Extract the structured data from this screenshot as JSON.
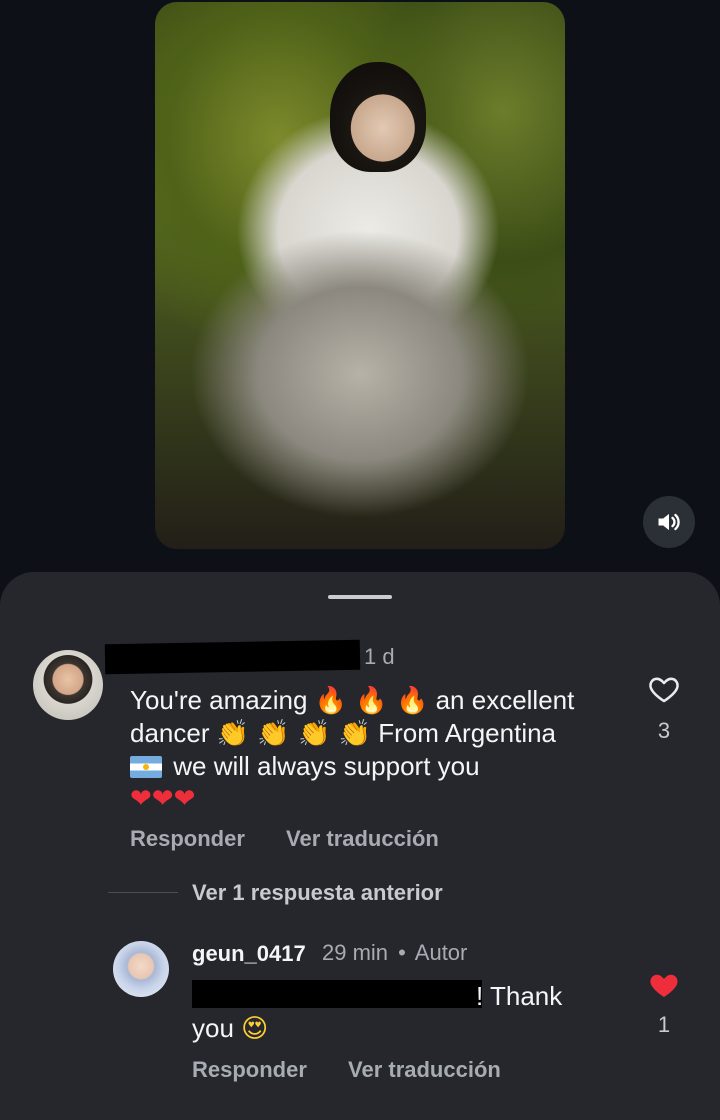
{
  "video": {
    "sound_icon": "volume-icon"
  },
  "comments": [
    {
      "timestamp": "1 d",
      "text_part1": "You're amazing",
      "fire_emojis": "🔥 🔥 🔥",
      "text_part2": "an excellent",
      "text_line2_start": "dancer",
      "clap_emojis": "👏 👏 👏 👏",
      "text_line2_end": "From Argentina",
      "text_line3": "we will always support you",
      "hearts": "❤❤❤",
      "reply_label": "Responder",
      "translate_label": "Ver traducción",
      "like_count": "3",
      "like_icon": "heart-outline-icon"
    }
  ],
  "replies_toggle": "Ver 1 respuesta anterior",
  "reply": {
    "username": "geun_0417",
    "timestamp": "29 min",
    "separator": "•",
    "author_label": "Autor",
    "text_line1_end": "! Thank",
    "text_line2": "you",
    "emoji": "😍",
    "reply_label": "Responder",
    "translate_label": "Ver traducción",
    "like_count": "1",
    "like_icon": "heart-filled-icon",
    "like_color": "#ef2e3c"
  }
}
